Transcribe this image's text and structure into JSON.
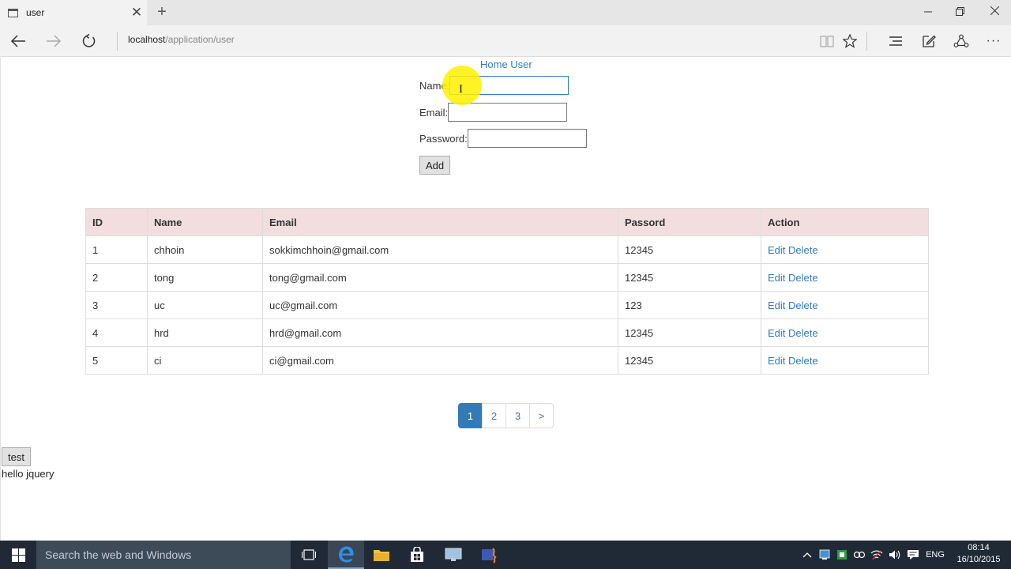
{
  "browser": {
    "tab_title": "user",
    "tab_close": "✕",
    "new_tab": "+",
    "address_host": "localhost",
    "address_path": "/application/user",
    "more_label": "···"
  },
  "page": {
    "home_link": "Home User",
    "form": {
      "name_label": "Name:",
      "name_value": "",
      "email_label": "Email:",
      "email_value": "",
      "password_label": "Password:",
      "password_value": "",
      "add_button": "Add"
    },
    "table": {
      "headers": [
        "ID",
        "Name",
        "Email",
        "Passord",
        "Action"
      ],
      "edit_label": "Edit",
      "delete_label": "Delete",
      "rows": [
        {
          "id": "1",
          "name": "chhoin",
          "email": "sokkimchhoin@gmail.com",
          "password": "12345"
        },
        {
          "id": "2",
          "name": "tong",
          "email": "tong@gmail.com",
          "password": "12345"
        },
        {
          "id": "3",
          "name": "uc",
          "email": "uc@gmail.com",
          "password": "123"
        },
        {
          "id": "4",
          "name": "hrd",
          "email": "hrd@gmail.com",
          "password": "12345"
        },
        {
          "id": "5",
          "name": "ci",
          "email": "ci@gmail.com",
          "password": "12345"
        }
      ]
    },
    "pagination": {
      "pages": [
        "1",
        "2",
        "3",
        ">"
      ],
      "active_page": "1"
    },
    "test_button": "test",
    "hello_text": "hello jquery"
  },
  "taskbar": {
    "search_placeholder": "Search the web and Windows",
    "language": "ENG",
    "time": "08:14",
    "date": "16/10/2015"
  },
  "colors": {
    "link": "#337ab7",
    "table_header_bg": "#f2dede",
    "cursor_highlight": "#fff100",
    "taskbar_bg": "#1f2a36"
  }
}
